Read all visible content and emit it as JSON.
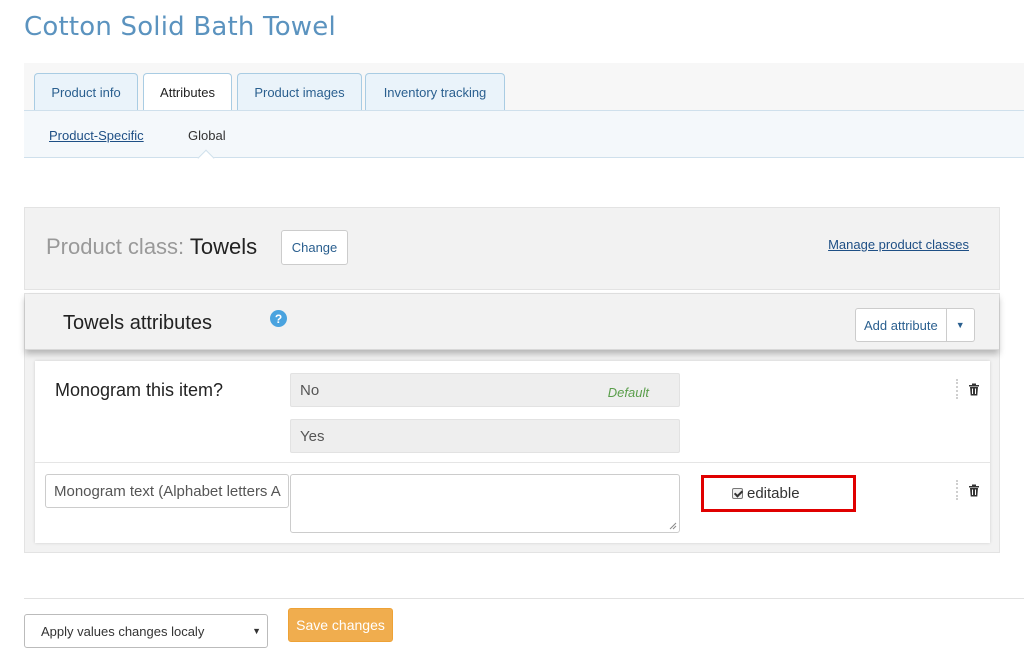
{
  "page": {
    "title": "Cotton Solid Bath Towel"
  },
  "tabs": [
    {
      "label": "Product info"
    },
    {
      "label": "Attributes"
    },
    {
      "label": "Product images"
    },
    {
      "label": "Inventory tracking"
    }
  ],
  "subtabs": {
    "product_specific": "Product-Specific",
    "global": "Global"
  },
  "product_class": {
    "label": "Product class:",
    "value": "Towels",
    "change_button": "Change",
    "manage_link": "Manage product classes"
  },
  "attributes": {
    "title": "Towels attributes",
    "help_icon": "question-circle-icon",
    "add_button": "Add attribute",
    "items": [
      {
        "name": "Monogram this item?",
        "values": [
          {
            "text": "No",
            "tag": "Default"
          },
          {
            "text": "Yes"
          }
        ]
      },
      {
        "name": "Monogram text (Alphabet letters A",
        "value": "",
        "editable_label": "editable",
        "editable_checked": true
      }
    ]
  },
  "footer": {
    "apply_select": "Apply values changes localy",
    "save_button": "Save changes"
  },
  "colors": {
    "title": "#5b93bf",
    "link": "#1e4f85",
    "save_button": "#f0ad4e",
    "highlight_border": "#e00000",
    "default_tag": "#5a9e4b"
  }
}
